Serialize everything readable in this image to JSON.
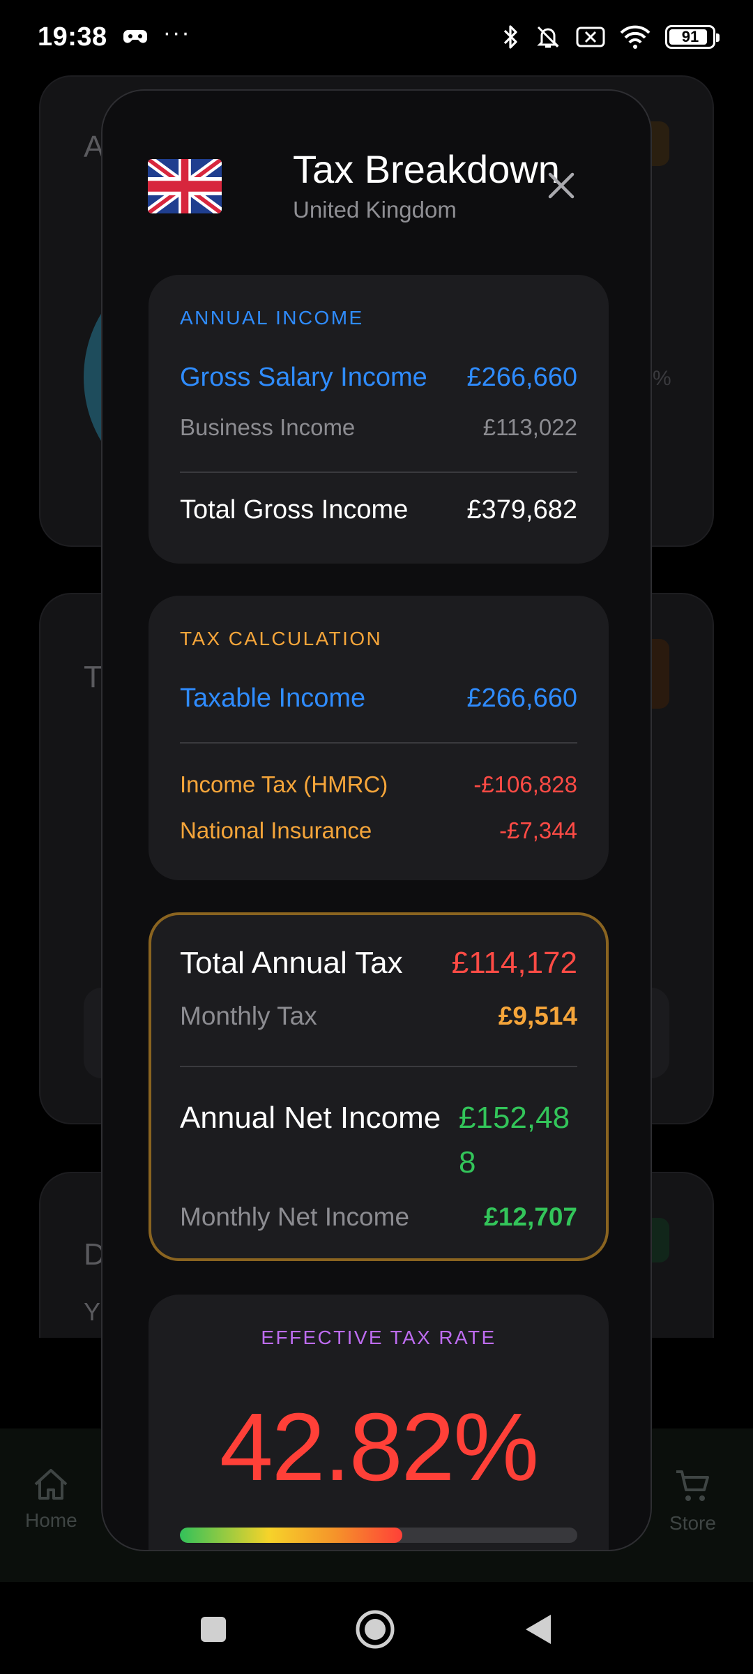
{
  "status_bar": {
    "time": "19:38",
    "overflow": "···",
    "battery_level": "91",
    "battery_fraction": 0.91
  },
  "background_app": {
    "card_letters": [
      "A",
      "T",
      "D"
    ],
    "card_subletter": "Y",
    "percent_hint": "%",
    "nav": [
      {
        "label": "Home",
        "icon": "home-icon"
      },
      {
        "label": "Store",
        "icon": "cart-icon"
      }
    ]
  },
  "dialog": {
    "title": "Tax Breakdown",
    "subtitle": "United Kingdom",
    "flag_icon": "uk-flag-icon",
    "close_icon": "close-icon",
    "annual_income": {
      "heading": "ANNUAL INCOME",
      "gross_salary_label": "Gross Salary Income",
      "gross_salary_value": "£266,660",
      "business_label": "Business Income",
      "business_value": "£113,022",
      "total_label": "Total Gross Income",
      "total_value": "£379,682"
    },
    "tax_calculation": {
      "heading": "TAX CALCULATION",
      "taxable_label": "Taxable Income",
      "taxable_value": "£266,660",
      "income_tax_label": "Income Tax (HMRC)",
      "income_tax_value": "-£106,828",
      "ni_label": "National Insurance",
      "ni_value": "-£7,344"
    },
    "totals": {
      "total_tax_label": "Total Annual Tax",
      "total_tax_value": "£114,172",
      "monthly_tax_label": "Monthly Tax",
      "monthly_tax_value": "£9,514",
      "net_label": "Annual Net Income",
      "net_value_line1": "£152,48",
      "net_value_line2": "8",
      "monthly_net_label": "Monthly Net Income",
      "monthly_net_value": "£12,707"
    },
    "effective_rate": {
      "heading": "EFFECTIVE TAX RATE",
      "value": "42.82%",
      "bar_fraction": 0.56
    }
  },
  "colors": {
    "accent_blue": "#2f8cff",
    "accent_orange": "#f5a53a",
    "negative_red": "#ff4b45",
    "positive_green": "#33c55a",
    "rate_purple": "#bd6cf0",
    "highlight_border": "#8a6420"
  }
}
